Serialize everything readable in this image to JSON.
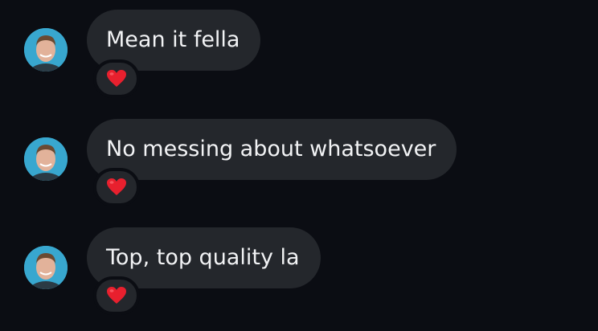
{
  "messages": [
    {
      "text": "Mean it fella",
      "reaction": "heart-icon"
    },
    {
      "text": "No messing about whatsoever",
      "reaction": "heart-icon"
    },
    {
      "text": "Top, top quality la",
      "reaction": "heart-icon"
    }
  ],
  "colors": {
    "background": "#0b0d13",
    "bubble": "#24272c",
    "text": "#f2f3f5",
    "heart": "#e8202e",
    "avatar_bg": "#38a7cf"
  }
}
